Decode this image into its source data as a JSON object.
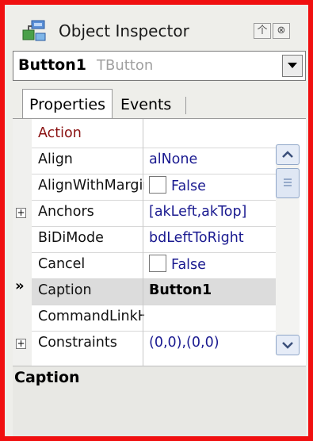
{
  "window": {
    "title": "Object Inspector",
    "pin_glyph": "个",
    "close_glyph": "⊗"
  },
  "component": {
    "name": "Button1",
    "type": "TButton"
  },
  "tabs": [
    {
      "label": "Properties",
      "active": true
    },
    {
      "label": "Events",
      "active": false
    }
  ],
  "properties": [
    {
      "name": "Action",
      "value": "",
      "category": true
    },
    {
      "name": "Align",
      "value": "alNone"
    },
    {
      "name": "AlignWithMargins",
      "value": "False",
      "checkbox": true
    },
    {
      "name": "Anchors",
      "value": "[akLeft,akTop]",
      "expandable": true
    },
    {
      "name": "BiDiMode",
      "value": "bdLeftToRight"
    },
    {
      "name": "Cancel",
      "value": "False",
      "checkbox": true
    },
    {
      "name": "Caption",
      "value": "Button1",
      "selected": true
    },
    {
      "name": "CommandLinkHint",
      "value": ""
    },
    {
      "name": "Constraints",
      "value": "(0,0),(0,0)",
      "expandable": true
    }
  ],
  "selected_marker": "»",
  "description": {
    "title": "Caption"
  },
  "colors": {
    "frame_border": "#f01010",
    "value_text": "#1a1a90",
    "category_text": "#8a1010"
  }
}
